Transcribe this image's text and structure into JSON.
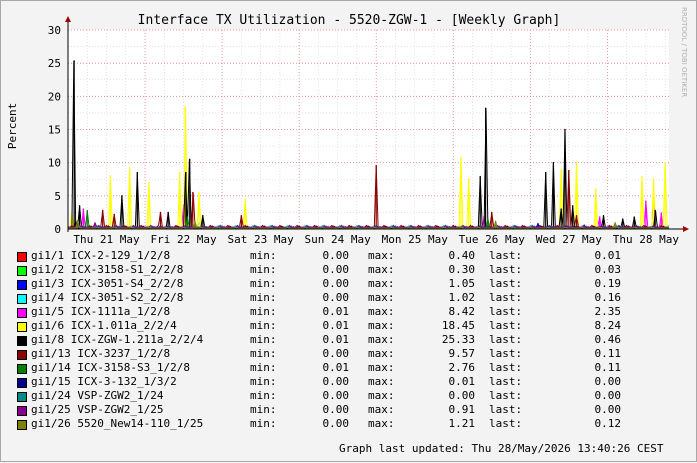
{
  "watermark": "RRDTOOL / TOBI OETIKER",
  "legend_labels": {
    "min": "min:",
    "max": "max:",
    "last": "last:"
  },
  "footer": {
    "updated": "Graph last updated: Thu 28/May/2026 13:40:26 CEST"
  },
  "chart_data": {
    "type": "line",
    "title": "Interface TX Utilization - 5520-ZGW-1 - [Weekly Graph]",
    "ylabel": "Percent",
    "xlabel": "",
    "ylim": [
      0,
      30
    ],
    "yticks": [
      0,
      5,
      10,
      15,
      20,
      25,
      30
    ],
    "xlim": [
      0,
      7.8
    ],
    "grid": true,
    "legend_position": "bottom",
    "x_ticks": [
      {
        "label": "Thu 21 May",
        "x": 0.5
      },
      {
        "label": "Fri 22 May",
        "x": 1.5
      },
      {
        "label": "Sat 23 May",
        "x": 2.5
      },
      {
        "label": "Sun 24 May",
        "x": 3.5
      },
      {
        "label": "Mon 25 May",
        "x": 4.5
      },
      {
        "label": "Tue 26 May",
        "x": 5.5
      },
      {
        "label": "Wed 27 May",
        "x": 6.5
      },
      {
        "label": "Thu 28 May",
        "x": 7.5
      }
    ],
    "day_lines": [
      0,
      1,
      2,
      3,
      4,
      5,
      6,
      7
    ],
    "series": [
      {
        "name": "gi1/1 ICX-2-129_1/2/8",
        "color": "#ff0000",
        "min": "0.00",
        "max": "0.40",
        "last": "0.01",
        "spikes": [
          [
            0.3,
            0.3
          ],
          [
            1.4,
            0.4
          ],
          [
            5.3,
            0.3
          ],
          [
            6.3,
            0.4
          ]
        ]
      },
      {
        "name": "gi1/2 ICX-3158-S1_2/2/8",
        "color": "#00ff00",
        "min": "0.00",
        "max": "0.30",
        "last": "0.03",
        "spikes": [
          [
            0.6,
            0.3
          ],
          [
            5.6,
            0.3
          ]
        ]
      },
      {
        "name": "gi1/3 ICX-3051-S4_2/2/8",
        "color": "#0000ff",
        "min": "0.00",
        "max": "1.05",
        "last": "0.19",
        "spikes": [
          [
            0.1,
            1.05
          ],
          [
            6.1,
            0.8
          ]
        ]
      },
      {
        "name": "gi1/4 ICX-3051-S2_2/2/8",
        "color": "#00ffff",
        "min": "0.00",
        "max": "1.02",
        "last": "0.16",
        "spikes": [
          [
            1.7,
            1.02
          ],
          [
            6.6,
            0.7
          ]
        ]
      },
      {
        "name": "gi1/5 ICX-1111a_1/2/8",
        "color": "#ff00ff",
        "min": "0.01",
        "max": "8.42",
        "last": "2.35",
        "spikes": [
          [
            0.2,
            3.0
          ],
          [
            1.5,
            3.6
          ],
          [
            5.4,
            1.9
          ],
          [
            6.9,
            1.8
          ],
          [
            7.5,
            4.2
          ],
          [
            7.6,
            5.8
          ],
          [
            7.7,
            2.4
          ]
        ]
      },
      {
        "name": "gi1/6 ICX-1.011a_2/2/4",
        "color": "#ffff00",
        "min": "0.01",
        "max": "18.45",
        "last": "8.24",
        "spikes": [
          [
            0.05,
            2.5
          ],
          [
            0.55,
            8.0
          ],
          [
            0.8,
            9.2
          ],
          [
            1.05,
            7.0
          ],
          [
            1.45,
            8.5
          ],
          [
            1.52,
            18.45
          ],
          [
            1.7,
            5.5
          ],
          [
            2.3,
            4.5
          ],
          [
            5.1,
            10.8
          ],
          [
            5.2,
            7.5
          ],
          [
            6.4,
            9.0
          ],
          [
            6.6,
            10.0
          ],
          [
            6.85,
            6.0
          ],
          [
            7.45,
            7.9
          ],
          [
            7.6,
            7.5
          ],
          [
            7.75,
            10.0
          ]
        ]
      },
      {
        "name": "gi1/8 ICX-ZGW-1.211a_2/2/4",
        "color": "#000000",
        "min": "0.01",
        "max": "25.33",
        "last": "0.46",
        "spikes": [
          [
            0.08,
            25.33
          ],
          [
            0.15,
            3.5
          ],
          [
            0.7,
            5.0
          ],
          [
            0.9,
            8.5
          ],
          [
            1.3,
            2.5
          ],
          [
            1.53,
            8.5
          ],
          [
            1.58,
            10.5
          ],
          [
            1.75,
            2.0
          ],
          [
            5.35,
            7.9
          ],
          [
            5.42,
            18.2
          ],
          [
            6.2,
            8.5
          ],
          [
            6.3,
            10.0
          ],
          [
            6.4,
            3.0
          ],
          [
            6.45,
            15.0
          ],
          [
            6.55,
            3.5
          ],
          [
            6.95,
            2.0
          ],
          [
            7.2,
            1.5
          ],
          [
            7.35,
            1.8
          ],
          [
            7.62,
            2.8
          ]
        ]
      },
      {
        "name": "gi1/13 ICX-3237_1/2/8",
        "color": "#8b0000",
        "min": "0.00",
        "max": "9.57",
        "last": "0.11",
        "spikes": [
          [
            0.45,
            2.8
          ],
          [
            0.6,
            2.2
          ],
          [
            1.2,
            2.5
          ],
          [
            1.62,
            5.5
          ],
          [
            2.25,
            2.0
          ],
          [
            4.0,
            9.57
          ],
          [
            5.5,
            2.5
          ],
          [
            6.5,
            8.8
          ],
          [
            6.6,
            2.0
          ]
        ]
      },
      {
        "name": "gi1/14 ICX-3158-S3_1/2/8",
        "color": "#008000",
        "min": "0.01",
        "max": "2.76",
        "last": "0.11",
        "spikes": [
          [
            0.25,
            2.76
          ],
          [
            1.55,
            1.8
          ],
          [
            5.45,
            1.5
          ]
        ]
      },
      {
        "name": "gi1/15 ICX-3-132_1/3/2",
        "color": "#00008b",
        "min": "0.00",
        "max": "0.01",
        "last": "0.00",
        "spikes": []
      },
      {
        "name": "gi1/24 VSP-ZGW2_1/24",
        "color": "#008b8b",
        "min": "0.00",
        "max": "0.00",
        "last": "0.00",
        "spikes": []
      },
      {
        "name": "gi1/25 VSP-ZGW2_1/25",
        "color": "#8b008b",
        "min": "0.00",
        "max": "0.91",
        "last": "0.00",
        "spikes": [
          [
            0.35,
            0.91
          ],
          [
            6.7,
            0.6
          ]
        ]
      },
      {
        "name": "gi1/26 5520_New14-110_1/25",
        "color": "#808000",
        "min": "0.00",
        "max": "1.21",
        "last": "0.12",
        "spikes": [
          [
            0.12,
            1.21
          ],
          [
            1.65,
            1.0
          ],
          [
            5.55,
            1.1
          ],
          [
            7.1,
            0.9
          ]
        ]
      }
    ]
  }
}
